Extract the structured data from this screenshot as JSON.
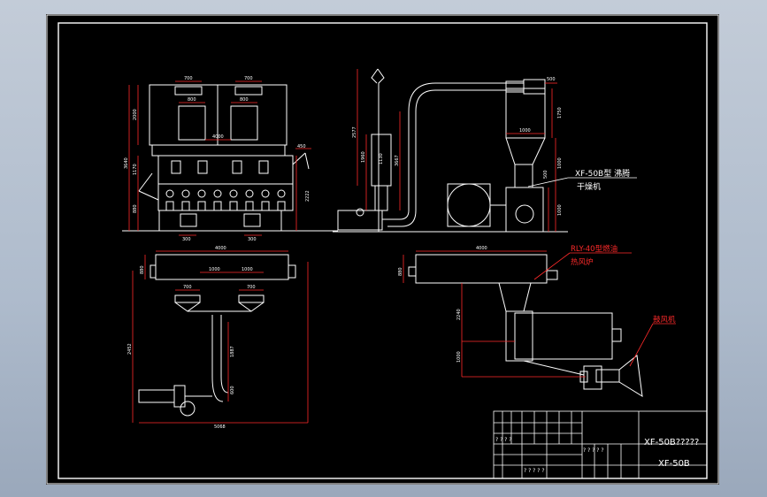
{
  "annotations": {
    "machine_label": "XF-50B型 沸腾",
    "dryer_label": "干燥机",
    "furnace_label_1": "RLY-40型燃油",
    "furnace_label_2": "热风炉",
    "fan_label": "鼓风机"
  },
  "dimensions": {
    "top_w1": "700",
    "top_w2": "700",
    "inner_w1": "800",
    "inner_w2": "800",
    "inner_mid": "4000",
    "height_total": "3640",
    "height_upper": "2000",
    "height_mid": "1170",
    "height_lower": "880",
    "side_w": "450",
    "side_h": "2222",
    "base_a": "300",
    "base_b": "300",
    "stack_h": "2577",
    "stack_mid": "1960",
    "stack_low": "1130",
    "pipe_h": "3667",
    "cyc_top": "500",
    "cyc_w": "1000",
    "cyc_h1": "1750",
    "cyc_h2": "1000",
    "cyc_h3": "500",
    "cyc_h4": "1000",
    "plan_w": "4000",
    "plan_d": "880",
    "plan_s1": "1000",
    "plan_s2": "1000",
    "plan_700a": "700",
    "plan_700b": "700",
    "plan_depth": "2452",
    "plan_dn1": "1887",
    "plan_dn2": "600",
    "plan_total": "5068",
    "furn_w": "4000",
    "furn_h": "880",
    "furn_d1": "2240",
    "furn_d2": "1000"
  },
  "title_block": {
    "drawing_name": "XF-50B?????",
    "drawing_no": "XF-50B",
    "row_a": "? ? ? ?",
    "row_b": "? ? ? ? ?",
    "row_c": "? ? ? ? ?"
  }
}
